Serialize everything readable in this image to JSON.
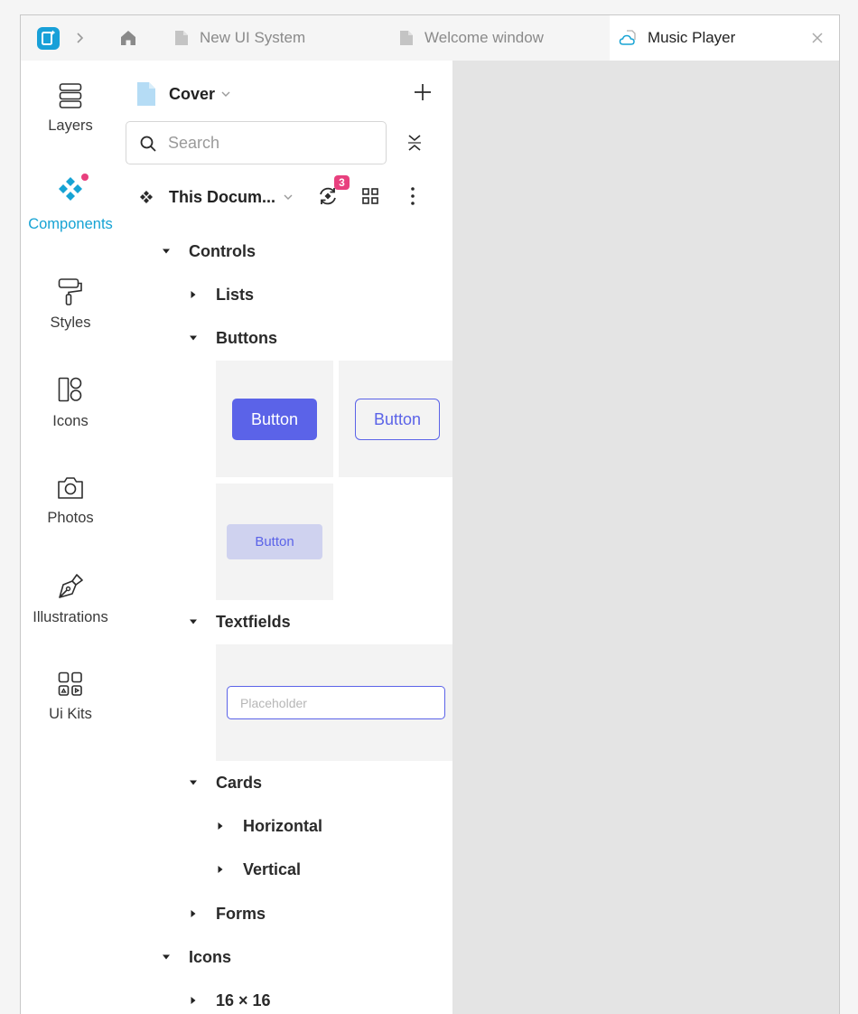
{
  "tabs": {
    "items": [
      {
        "label": "New UI System"
      },
      {
        "label": "Welcome window"
      }
    ],
    "active": {
      "label": "Music Player"
    }
  },
  "rail": {
    "items": [
      {
        "label": "Layers",
        "icon": "layers-icon"
      },
      {
        "label": "Components",
        "icon": "components-icon",
        "active": true,
        "has_notification": true
      },
      {
        "label": "Styles",
        "icon": "paint-roller-icon"
      },
      {
        "label": "Icons",
        "icon": "icons-icon"
      },
      {
        "label": "Photos",
        "icon": "camera-icon"
      },
      {
        "label": "Illustrations",
        "icon": "pen-icon"
      },
      {
        "label": "Ui Kits",
        "icon": "ui-kits-icon"
      }
    ]
  },
  "panel": {
    "page_title": "Cover",
    "search_placeholder": "Search",
    "library_title": "This Docum...",
    "sync_badge": "3"
  },
  "tree": {
    "controls": "Controls",
    "lists": "Lists",
    "buttons": "Buttons",
    "textfields": "Textfields",
    "cards": "Cards",
    "horizontal": "Horizontal",
    "vertical": "Vertical",
    "forms": "Forms",
    "icons": "Icons",
    "size_16": "16 × 16"
  },
  "previews": {
    "button_filled": "Button",
    "button_outline": "Button",
    "button_soft": "Button",
    "textfield_placeholder": "Placeholder"
  },
  "colors": {
    "accent": "#16a3d4",
    "primary_button": "#5b63e8",
    "badge": "#e8407e",
    "canvas": "#e4e4e4"
  }
}
